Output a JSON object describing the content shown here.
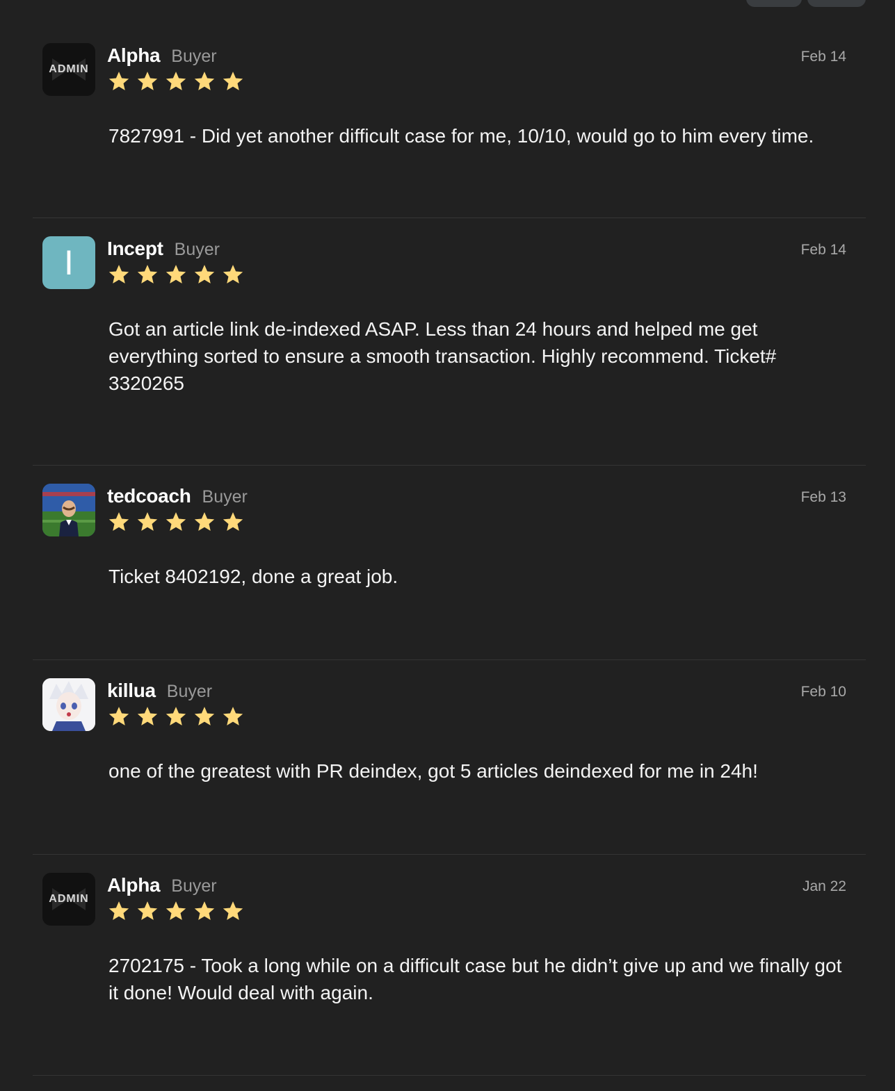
{
  "colors": {
    "background": "#212121",
    "star": "#FFD97A",
    "divider": "#353535",
    "role_text": "#9a9a9a"
  },
  "reviews": [
    {
      "avatar": {
        "type": "admin-logo",
        "text": "ADMIN"
      },
      "username": "Alpha",
      "role": "Buyer",
      "date": "Feb 14",
      "rating": 5,
      "text": "7827991 - Did yet another difficult case for me, 10/10, would go to him every time."
    },
    {
      "avatar": {
        "type": "letter",
        "text": "I",
        "color": "#6fb6c0"
      },
      "username": "Incept",
      "role": "Buyer",
      "date": "Feb 14",
      "rating": 5,
      "text": "Got an article link de-indexed ASAP. Less than 24 hours and helped me get everything sorted to ensure a smooth transaction. Highly recommend. Ticket# 3320265"
    },
    {
      "avatar": {
        "type": "photo"
      },
      "username": "tedcoach",
      "role": "Buyer",
      "date": "Feb 13",
      "rating": 5,
      "text": "Ticket 8402192, done a great job."
    },
    {
      "avatar": {
        "type": "anime-picture"
      },
      "username": "killua",
      "role": "Buyer",
      "date": "Feb 10",
      "rating": 5,
      "text": "one of the greatest with PR deindex, got 5 articles deindexed for me in 24h!"
    },
    {
      "avatar": {
        "type": "admin-logo",
        "text": "ADMIN"
      },
      "username": "Alpha",
      "role": "Buyer",
      "date": "Jan 22",
      "rating": 5,
      "text": "2702175 - Took a long while on a difficult case but he didn’t give up and we finally got it done! Would deal with again."
    }
  ]
}
